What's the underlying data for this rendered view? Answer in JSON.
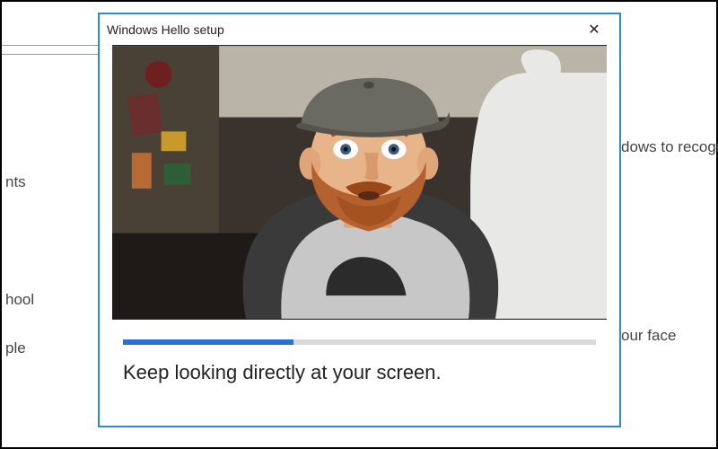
{
  "dialog": {
    "title": "Windows Hello setup",
    "close_label": "Close",
    "instruction": "Keep looking directly at your screen.",
    "progress_percent": 36
  },
  "background": {
    "fragments": {
      "accounts": "nts",
      "school": "hool",
      "people": "ple",
      "recognize": "dows to recogniz",
      "your_face": "our face"
    }
  },
  "icons": {
    "close": "✕"
  },
  "colors": {
    "dialog_border": "#2a8dd4",
    "progress": "#2a6fd4",
    "progress_track": "#d9d9d9"
  }
}
